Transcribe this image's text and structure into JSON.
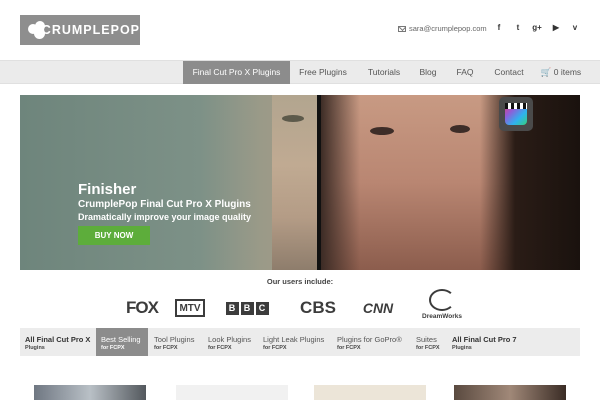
{
  "header": {
    "logo_text": "CRUMPLEPOP",
    "email": "sara@crumplepop.com",
    "social": [
      "f",
      "t",
      "g+",
      "▶",
      "v"
    ]
  },
  "nav": {
    "items": [
      "Final Cut Pro X Plugins",
      "Free Plugins",
      "Tutorials",
      "Blog",
      "FAQ",
      "Contact"
    ],
    "cart": "0 items"
  },
  "hero": {
    "title": "Finisher",
    "subtitle": "CrumplePop Final Cut Pro X Plugins",
    "description": "Dramatically improve your image quality",
    "button": "BUY NOW"
  },
  "users": {
    "title": "Our users include:",
    "brands": [
      "FOX",
      "MTV",
      "BBC",
      "CBS",
      "CNN",
      "DreamWorks"
    ]
  },
  "categories": [
    {
      "main": "All Final Cut Pro X",
      "sub": "Plugins"
    },
    {
      "main": "Best Selling",
      "sub": "for FCPX"
    },
    {
      "main": "Tool Plugins",
      "sub": "for FCPX"
    },
    {
      "main": "Look Plugins",
      "sub": "for FCPX"
    },
    {
      "main": "Light Leak Plugins",
      "sub": "for FCPX"
    },
    {
      "main": "Plugins for GoPro®",
      "sub": "for FCPX"
    },
    {
      "main": "Suites",
      "sub": "for FCPX"
    },
    {
      "main": "All Final Cut Pro 7",
      "sub": "Plugins"
    }
  ],
  "colors": {
    "nav_active": "#8c8c8c",
    "buy_button": "#5dad3b",
    "logo_bg": "#8e8e8e"
  }
}
